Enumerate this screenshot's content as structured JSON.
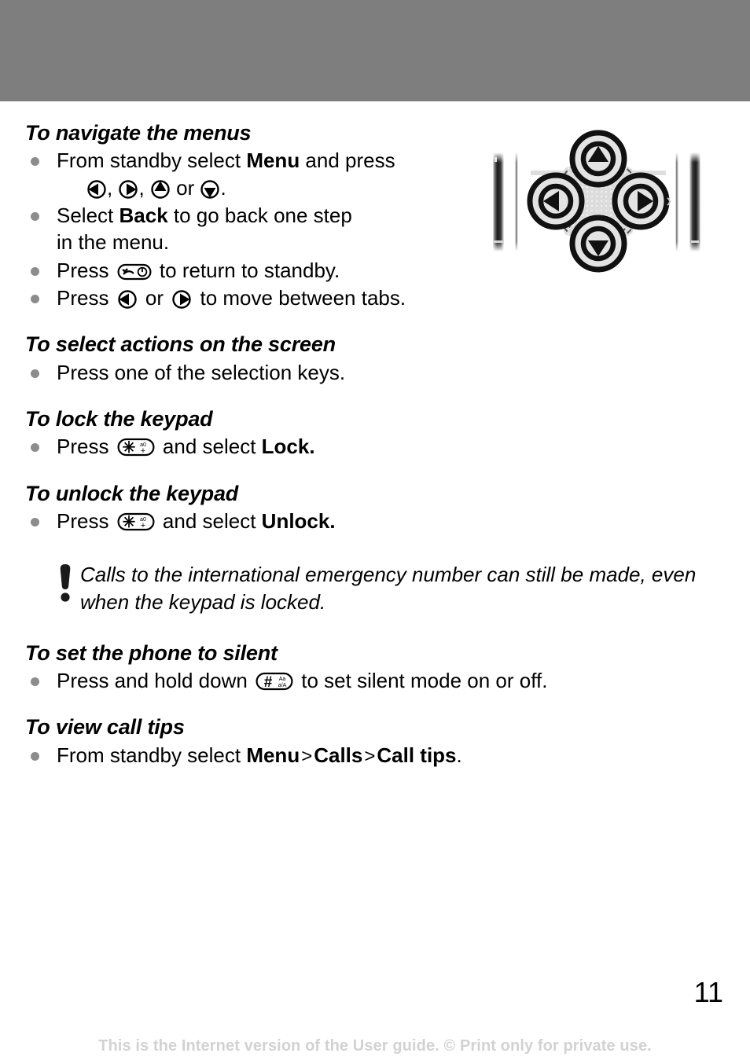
{
  "page": {
    "number": "11",
    "footer_text": "This is the Internet version of the User guide. © Print only for private use.",
    "header_band_color": "#7e7e7e",
    "bullet_color": "#8c8c8c",
    "footer_color": "#d2d2d2"
  },
  "sections": [
    {
      "id": "navigate-the-menus",
      "title": "To navigate the menus",
      "items": [
        {
          "id": "from-standby-select-menu",
          "pre": "From standby select ",
          "keyword": "Menu",
          "post": " and press",
          "second_line_keys": [
            "nav-left-key",
            "nav-right-key",
            "nav-up-key",
            "nav-down-key"
          ],
          "second_line_separators": [
            ", ",
            ", ",
            " or ",
            "."
          ]
        },
        {
          "id": "select-back",
          "pre": "Select ",
          "keyword": "Back",
          "post": " to go back one step",
          "wrap": "in the menu."
        },
        {
          "id": "press-end-key",
          "pre": "Press ",
          "key": "end-call-key",
          "post": " to return to standby."
        },
        {
          "id": "press-left-right",
          "pre": "Press ",
          "key": "nav-left-key",
          "mid": " or ",
          "key2": "nav-right-key",
          "post": " to move between tabs."
        }
      ]
    },
    {
      "id": "select-actions-on-the-screen",
      "title": "To select actions on the screen",
      "items": [
        {
          "id": "press-selection-keys",
          "pre": "Press one of the selection keys."
        }
      ]
    },
    {
      "id": "lock-the-keypad",
      "title": "To lock the keypad",
      "items": [
        {
          "id": "press-star-lock",
          "pre": "Press ",
          "key": "star-key",
          "mid": " and select ",
          "keyword": "Lock."
        }
      ]
    },
    {
      "id": "unlock-the-keypad",
      "title": "To unlock the keypad",
      "items": [
        {
          "id": "press-star-unlock",
          "pre": "Press ",
          "key": "star-key",
          "mid": " and select ",
          "keyword": "Unlock."
        }
      ]
    },
    {
      "id": "set-the-phone-to-silent",
      "title": "To set the phone to silent",
      "items": [
        {
          "id": "press-hold-hash",
          "pre": "Press and hold down ",
          "key": "hash-key",
          "post": " to set silent mode on or off."
        }
      ]
    },
    {
      "id": "view-call-tips",
      "title": "To view call tips",
      "items": [
        {
          "id": "menu-calls-call-tips",
          "pre": "From standby select ",
          "path": [
            "Menu",
            "Calls",
            "Call tips"
          ],
          "separator": ">",
          "post": "."
        }
      ]
    }
  ],
  "note": {
    "icon": "exclamation-icon",
    "text": "Calls to the international emergency number can still be made, even when the keypad is locked."
  },
  "figure": {
    "id": "navigation-key-illustration",
    "keys": [
      "up",
      "left",
      "right",
      "down"
    ],
    "description": "Navigation key illustration"
  }
}
